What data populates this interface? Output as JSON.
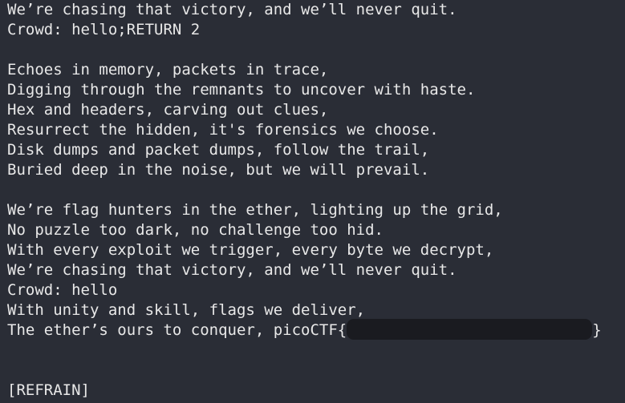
{
  "terminal": {
    "background_color": "#2a2d36",
    "text_color": "#e8e8e8",
    "lines": [
      "We’re chasing that victory, and we’ll never quit.",
      "Crowd: hello;RETURN 2",
      "",
      "Echoes in memory, packets in trace,",
      "Digging through the remnants to uncover with haste.",
      "Hex and headers, carving out clues,",
      "Resurrect the hidden, it's forensics we choose.",
      "Disk dumps and packet dumps, follow the trail,",
      "Buried deep in the noise, but we will prevail.",
      "",
      "We’re flag hunters in the ether, lighting up the grid,",
      "No puzzle too dark, no challenge too hid.",
      "With every exploit we trigger, every byte we decrypt,",
      "We’re chasing that victory, and we’ll never quit.",
      "Crowd: hello",
      "With unity and skill, flags we deliver,"
    ],
    "flag_line": {
      "prefix": "The ether’s ours to conquer, picoCTF{",
      "suffix": "}"
    },
    "trailing_lines": [
      "",
      "",
      "[REFRAIN]"
    ]
  }
}
